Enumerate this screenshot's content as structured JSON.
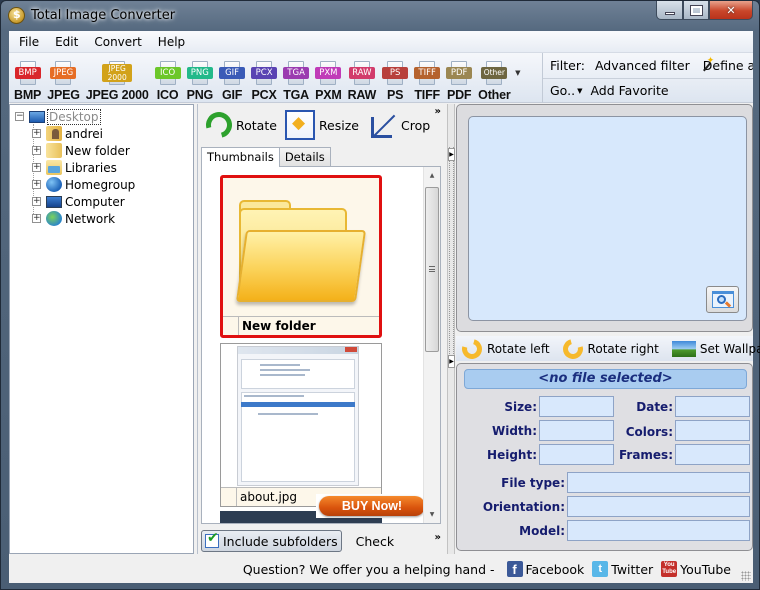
{
  "window": {
    "title": "Total Image Converter",
    "controls": {
      "minimize": "minimize",
      "maximize": "maximize",
      "close": "close"
    }
  },
  "menu": [
    "File",
    "Edit",
    "Convert",
    "Help"
  ],
  "formats": [
    {
      "label": "BMP",
      "tag": "BMP",
      "color": "#d9262b"
    },
    {
      "label": "JPEG",
      "tag": "JPEG",
      "color": "#e66d25"
    },
    {
      "label": "JPEG 2000",
      "tag": "JPEG 2000",
      "color": "#d2a21a"
    },
    {
      "label": "ICO",
      "tag": "ICO",
      "color": "#6cc72a"
    },
    {
      "label": "PNG",
      "tag": "PNG",
      "color": "#22b98a"
    },
    {
      "label": "GIF",
      "tag": "GIF",
      "color": "#3a5bb7"
    },
    {
      "label": "PCX",
      "tag": "PCX",
      "color": "#5a43b3"
    },
    {
      "label": "TGA",
      "tag": "TGA",
      "color": "#9b3bb0"
    },
    {
      "label": "PXM",
      "tag": "PXM",
      "color": "#c03bb8"
    },
    {
      "label": "RAW",
      "tag": "RAW",
      "color": "#d23b6b"
    },
    {
      "label": "PS",
      "tag": "PS",
      "color": "#b8403c"
    },
    {
      "label": "TIFF",
      "tag": "TIFF",
      "color": "#b5622e"
    },
    {
      "label": "PDF",
      "tag": "PDF",
      "color": "#9b8752"
    },
    {
      "label": "Other",
      "tag": "Other",
      "color": "#6e6640"
    }
  ],
  "filter_bar": {
    "filter_label": "Filter:",
    "advanced_filter": "Advanced filter",
    "define_action": "Define ac",
    "go": "Go..",
    "add_favorite": "Add Favorite"
  },
  "tree": {
    "root": "Desktop",
    "items": [
      "andrei",
      "New folder",
      "Libraries",
      "Homegroup",
      "Computer",
      "Network"
    ]
  },
  "edit_toolbar": {
    "rotate": "Rotate",
    "resize": "Resize",
    "crop": "Crop",
    "more": "»"
  },
  "tabs": [
    "Thumbnails",
    "Details"
  ],
  "thumbnails": [
    {
      "caption": "New folder",
      "selected": true
    },
    {
      "caption": "about.jpg",
      "selected": false
    }
  ],
  "buy_now": "BUY Now!",
  "bottom_bar": {
    "include_subfolders": "Include subfolders",
    "check": "Check",
    "more": "»"
  },
  "rotate_bar": {
    "rotate_left": "Rotate left",
    "rotate_right": "Rotate right",
    "set_wallpaper": "Set Wallpaper"
  },
  "info": {
    "header": "<no file selected>",
    "fields": {
      "size": {
        "label": "Size:",
        "value": ""
      },
      "date": {
        "label": "Date:",
        "value": ""
      },
      "width": {
        "label": "Width:",
        "value": ""
      },
      "colors": {
        "label": "Colors:",
        "value": ""
      },
      "height": {
        "label": "Height:",
        "value": ""
      },
      "frames": {
        "label": "Frames:",
        "value": ""
      },
      "file_type": {
        "label": "File type:",
        "value": ""
      },
      "orientation": {
        "label": "Orientation:",
        "value": ""
      },
      "model": {
        "label": "Model:",
        "value": ""
      }
    }
  },
  "status": {
    "question": "Question? We offer you a helping hand -",
    "facebook": "Facebook",
    "twitter": "Twitter",
    "youtube": "YouTube"
  }
}
